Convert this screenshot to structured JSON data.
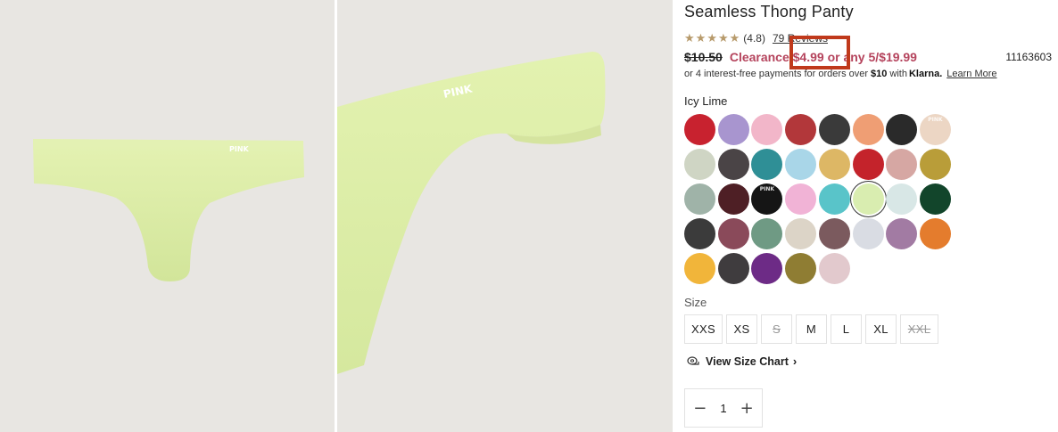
{
  "product": {
    "title": "Seamless Thong Panty",
    "rating": {
      "stars": 5,
      "star_glyph": "★",
      "value_text": "(4.8)",
      "reviews_text": "79 Reviews"
    },
    "price": {
      "original": "$10.50",
      "clearance_text": "Clearance $4.99 or any 5/$19.99",
      "sku": "11163603"
    },
    "financing": {
      "prefix": "or 4 interest-free payments for orders over",
      "amount": "$10",
      "with": "with",
      "provider": "Klarna.",
      "learn_more": "Learn More"
    },
    "brand_mark": "PINK",
    "selected_color": "Icy Lime",
    "swatches": [
      {
        "name": "red",
        "color": "#c8222f"
      },
      {
        "name": "lavender",
        "color": "#a895cf"
      },
      {
        "name": "pink",
        "color": "#f2b6c9"
      },
      {
        "name": "dark-red",
        "color": "#b2373a"
      },
      {
        "name": "charcoal",
        "color": "#3a3a3a"
      },
      {
        "name": "peach",
        "color": "#ef9e74"
      },
      {
        "name": "black-tiedye",
        "color": "#2a2a2a"
      },
      {
        "name": "nude-pink-logo",
        "color": "#ecd6c4"
      },
      {
        "name": "sage",
        "color": "#cfd5c4"
      },
      {
        "name": "black-white-print",
        "color": "#4a4446"
      },
      {
        "name": "teal-tiedye",
        "color": "#2f8f96"
      },
      {
        "name": "light-blue",
        "color": "#a9d6e8"
      },
      {
        "name": "mustard",
        "color": "#ddb765"
      },
      {
        "name": "crimson",
        "color": "#c4232b"
      },
      {
        "name": "dusty-rose",
        "color": "#d6a7a3"
      },
      {
        "name": "olive-gold",
        "color": "#b99d39"
      },
      {
        "name": "grey-green",
        "color": "#9fb3a8"
      },
      {
        "name": "burgundy",
        "color": "#4e1f25"
      },
      {
        "name": "black-logo",
        "color": "#151515"
      },
      {
        "name": "pink-tiedye",
        "color": "#f1b3d6"
      },
      {
        "name": "aqua-tiedye",
        "color": "#59c4c9"
      },
      {
        "name": "icy-lime",
        "color": "#d9edb0"
      },
      {
        "name": "ice-blue",
        "color": "#d8e7e6"
      },
      {
        "name": "forest-green",
        "color": "#12452b"
      },
      {
        "name": "black-white-tiedye",
        "color": "#3b3b3b"
      },
      {
        "name": "plum-print",
        "color": "#8a4a5a"
      },
      {
        "name": "green-tiedye",
        "color": "#6f9a84"
      },
      {
        "name": "cream",
        "color": "#dcd4c7"
      },
      {
        "name": "mauve-tiedye",
        "color": "#7b5a5e"
      },
      {
        "name": "pale-grey",
        "color": "#d9dce3"
      },
      {
        "name": "orchid",
        "color": "#a27ba3"
      },
      {
        "name": "orange-stripe",
        "color": "#e47c2d"
      },
      {
        "name": "marigold",
        "color": "#f1b53a"
      },
      {
        "name": "charcoal-stripe",
        "color": "#3f3c3e"
      },
      {
        "name": "purple",
        "color": "#6d2b86"
      },
      {
        "name": "olive-stripe",
        "color": "#8f7d33"
      },
      {
        "name": "blush-stripe",
        "color": "#e2c9cd"
      }
    ],
    "size_label": "Size",
    "sizes": [
      {
        "label": "XXS",
        "available": true
      },
      {
        "label": "XS",
        "available": true
      },
      {
        "label": "S",
        "available": false
      },
      {
        "label": "M",
        "available": true
      },
      {
        "label": "L",
        "available": true
      },
      {
        "label": "XL",
        "available": true
      },
      {
        "label": "XXL",
        "available": false
      }
    ],
    "size_chart": {
      "label": "View Size Chart",
      "chevron": "›"
    },
    "quantity": {
      "minus": "−",
      "value": "1",
      "plus": "+"
    }
  },
  "colors": {
    "clearance": "#b5445d",
    "star": "#b79a6b",
    "highlight": "#c0391b",
    "image_bg": "#e8e6e2",
    "garment": "#dcee9f"
  }
}
